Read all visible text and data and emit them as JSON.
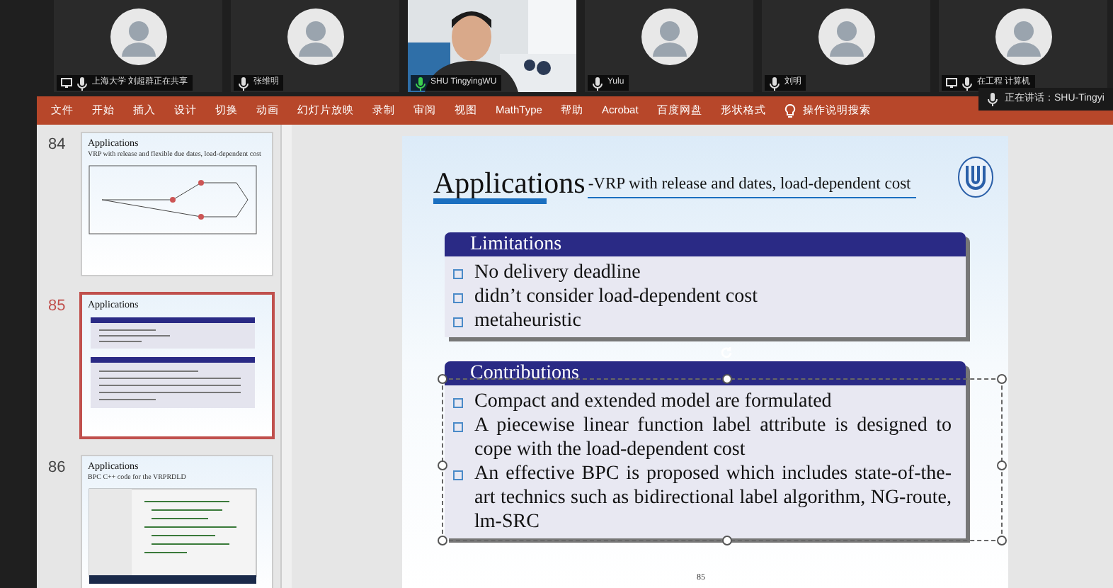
{
  "participants": [
    {
      "name": "上海大学 刘超群正在共享",
      "kind": "avatar",
      "speaking": false,
      "sharing": true
    },
    {
      "name": "张维明",
      "kind": "avatar",
      "speaking": false,
      "sharing": false
    },
    {
      "name": "SHU TingyingWU",
      "kind": "camera",
      "speaking": true,
      "sharing": false
    },
    {
      "name": "Yulu",
      "kind": "avatar",
      "speaking": false,
      "sharing": false
    },
    {
      "name": "刘明",
      "kind": "avatar",
      "speaking": false,
      "sharing": false
    },
    {
      "name": "在工程 计算机",
      "kind": "avatar",
      "speaking": false,
      "sharing": true
    }
  ],
  "speaking_banner": "正在讲话：SHU-Tingyi",
  "ribbon": {
    "tabs": [
      "文件",
      "开始",
      "插入",
      "设计",
      "切换",
      "动画",
      "幻灯片放映",
      "录制",
      "审阅",
      "视图",
      "MathType",
      "帮助",
      "Acrobat",
      "百度网盘",
      "形状格式"
    ],
    "search": "操作说明搜索"
  },
  "thumbnails": [
    {
      "number": "84",
      "selected": false,
      "title": "Applications",
      "heading": "VRP with release and flexible due dates, load-dependent cost",
      "kind": "diagram"
    },
    {
      "number": "85",
      "selected": true,
      "title": "Applications",
      "kind": "boxes"
    },
    {
      "number": "86",
      "selected": false,
      "title": "Applications",
      "heading": "BPC C++ code for the VRPRDLD",
      "kind": "code"
    }
  ],
  "slide": {
    "title": "Applications",
    "subtitle": "-VRP with release and dates, load-dependent cost",
    "boxes": [
      {
        "heading": "Limitations",
        "items": [
          "No delivery deadline",
          "didn’t consider load-dependent cost",
          "metaheuristic"
        ],
        "selected": false
      },
      {
        "heading": "Contributions",
        "items": [
          "Compact and extended model are formulated",
          "A piecewise linear function label attribute is designed to cope with the load-dependent cost",
          "An effective BPC is proposed which includes state-of-the-art technics such as bidirectional label algorithm, NG-route, lm-SRC"
        ],
        "selected": true
      }
    ],
    "page_number": "85"
  }
}
